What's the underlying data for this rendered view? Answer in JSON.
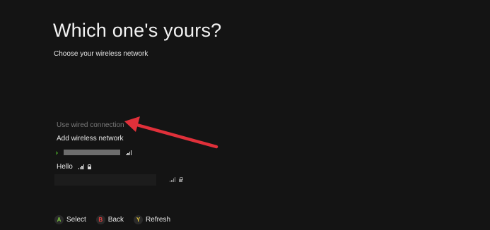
{
  "header": {
    "title": "Which one's yours?",
    "subtitle": "Choose your wireless network"
  },
  "options": {
    "wired": "Use wired connection",
    "add_wireless": "Add wireless network"
  },
  "networks": [
    {
      "name": "",
      "redacted": true,
      "selected": true,
      "signal_icon": "signal-icon"
    },
    {
      "name": "Hello",
      "redacted": false,
      "selected": false,
      "signal_icon": "signal-icon",
      "secured": true
    },
    {
      "name": "",
      "redacted": true,
      "selected": false,
      "signal_icon": "signal-icon",
      "secured": true
    }
  ],
  "footer": {
    "select": {
      "key": "A",
      "label": "Select"
    },
    "back": {
      "key": "B",
      "label": "Back"
    },
    "refresh": {
      "key": "Y",
      "label": "Refresh"
    }
  },
  "colors": {
    "background": "#141414",
    "selected_chevron": "#4caf2a",
    "button_a": "#7cc742",
    "button_b": "#e64040",
    "button_y": "#e6c83a",
    "annotation_arrow": "#e0303a"
  }
}
